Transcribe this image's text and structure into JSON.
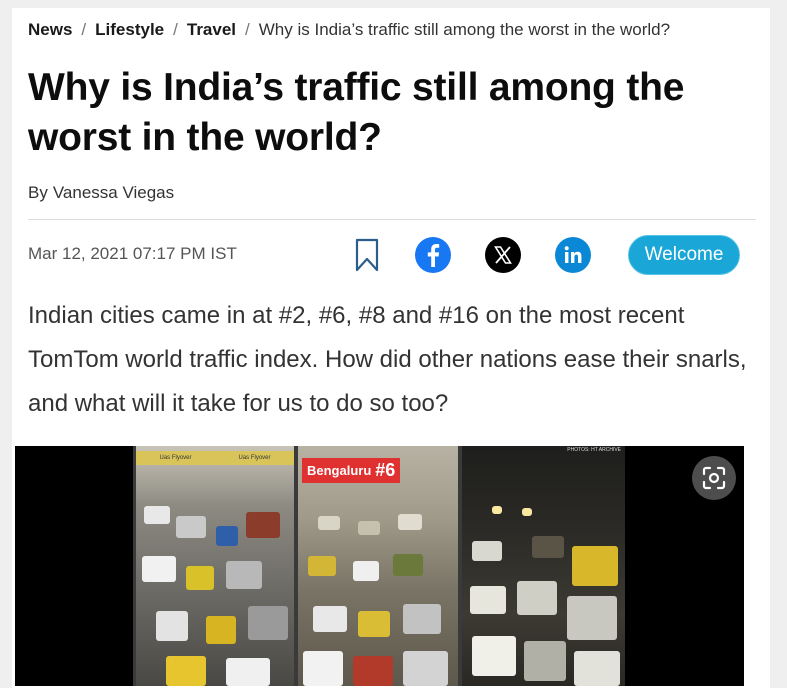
{
  "breadcrumb": {
    "items": [
      "News",
      "Lifestyle",
      "Travel"
    ],
    "current": "Why is India’s traffic still among the worst in the world?",
    "separator": "/"
  },
  "article": {
    "title": "Why is India’s traffic still among the worst in the world?",
    "byline_prefix": "By",
    "author": "Vanessa Viegas",
    "date": "Mar 12, 2021 07:17 PM IST",
    "summary": "Indian cities came in at #2, #6, #8 and #16 on the most recent TomTom world traffic index. How did other nations ease their snarls, and what will it take for us to do so too?"
  },
  "actions": {
    "bookmark_icon": "bookmark-icon",
    "share": [
      "facebook-icon",
      "x-icon",
      "linkedin-icon"
    ],
    "welcome_label": "Welcome"
  },
  "image": {
    "flyover_labels": [
      "Uas Flyover",
      "Uas Flyover"
    ],
    "city_label": "Bengaluru",
    "city_rank": "#6",
    "credit": "PHOTOS: HT ARCHIVE",
    "scan_icon": "image-search-icon"
  },
  "colors": {
    "facebook": "#1877f2",
    "x": "#000000",
    "linkedin": "#0a88d6",
    "welcome": "#1aa6d6",
    "label_red": "#e03131"
  }
}
